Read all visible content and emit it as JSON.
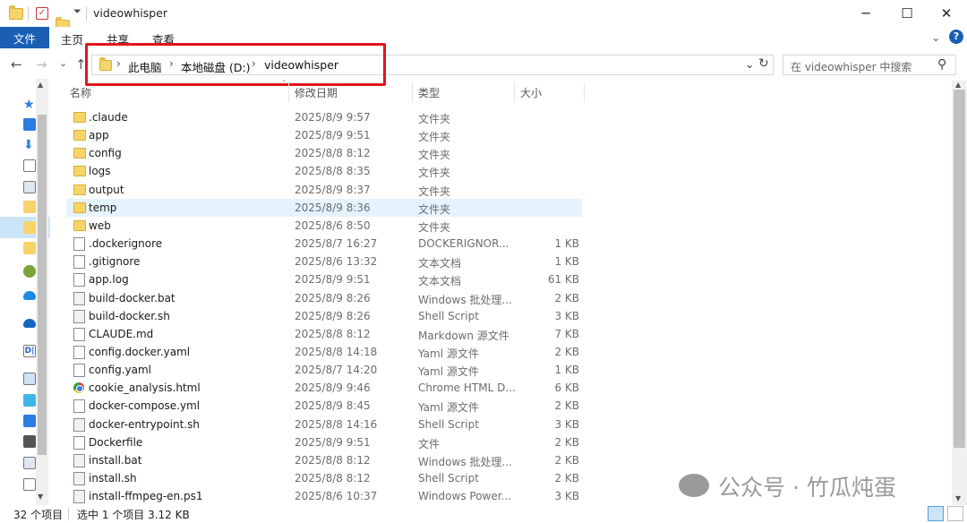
{
  "window": {
    "title": "videowhisper",
    "minimize": "─",
    "maximize": "☐",
    "close": "✕"
  },
  "ribbon": {
    "tabs": [
      "文件",
      "主页",
      "共享",
      "查看"
    ],
    "help": "?",
    "expand": "⌄"
  },
  "nav": {
    "back": "←",
    "forward": "→",
    "recent": "⌄",
    "up": "↑"
  },
  "address": {
    "crumbs": [
      "此电脑",
      "本地磁盘 (D:)",
      "videowhisper"
    ],
    "dropdown": "⌄",
    "refresh": "↻"
  },
  "search": {
    "placeholder": "在 videowhisper 中搜索",
    "icon": "⚲"
  },
  "columns": {
    "name": "名称",
    "date": "修改日期",
    "type": "类型",
    "size": "大小"
  },
  "files": [
    {
      "name": ".claude",
      "date": "2025/8/9 9:57",
      "type": "文件夹",
      "size": "",
      "icon": "folder"
    },
    {
      "name": "app",
      "date": "2025/8/9 9:51",
      "type": "文件夹",
      "size": "",
      "icon": "folder"
    },
    {
      "name": "config",
      "date": "2025/8/8 8:12",
      "type": "文件夹",
      "size": "",
      "icon": "folder"
    },
    {
      "name": "logs",
      "date": "2025/8/8 8:35",
      "type": "文件夹",
      "size": "",
      "icon": "folder"
    },
    {
      "name": "output",
      "date": "2025/8/9 8:37",
      "type": "文件夹",
      "size": "",
      "icon": "folder"
    },
    {
      "name": "temp",
      "date": "2025/8/9 8:36",
      "type": "文件夹",
      "size": "",
      "icon": "folder"
    },
    {
      "name": "web",
      "date": "2025/8/6 8:50",
      "type": "文件夹",
      "size": "",
      "icon": "folder"
    },
    {
      "name": ".dockerignore",
      "date": "2025/8/7 16:27",
      "type": "DOCKERIGNOR...",
      "size": "1 KB",
      "icon": "file"
    },
    {
      "name": ".gitignore",
      "date": "2025/8/6 13:32",
      "type": "文本文档",
      "size": "1 KB",
      "icon": "file"
    },
    {
      "name": "app.log",
      "date": "2025/8/9 9:51",
      "type": "文本文档",
      "size": "61 KB",
      "icon": "file"
    },
    {
      "name": "build-docker.bat",
      "date": "2025/8/9 8:26",
      "type": "Windows 批处理...",
      "size": "2 KB",
      "icon": "gear"
    },
    {
      "name": "build-docker.sh",
      "date": "2025/8/9 8:26",
      "type": "Shell Script",
      "size": "3 KB",
      "icon": "gear"
    },
    {
      "name": "CLAUDE.md",
      "date": "2025/8/8 8:12",
      "type": "Markdown 源文件",
      "size": "7 KB",
      "icon": "file"
    },
    {
      "name": "config.docker.yaml",
      "date": "2025/8/8 14:18",
      "type": "Yaml 源文件",
      "size": "2 KB",
      "icon": "file"
    },
    {
      "name": "config.yaml",
      "date": "2025/8/7 14:20",
      "type": "Yaml 源文件",
      "size": "1 KB",
      "icon": "file"
    },
    {
      "name": "cookie_analysis.html",
      "date": "2025/8/9 9:46",
      "type": "Chrome HTML D...",
      "size": "6 KB",
      "icon": "chrome"
    },
    {
      "name": "docker-compose.yml",
      "date": "2025/8/9 8:45",
      "type": "Yaml 源文件",
      "size": "2 KB",
      "icon": "file"
    },
    {
      "name": "docker-entrypoint.sh",
      "date": "2025/8/8 14:16",
      "type": "Shell Script",
      "size": "3 KB",
      "icon": "gear"
    },
    {
      "name": "Dockerfile",
      "date": "2025/8/9 9:51",
      "type": "文件",
      "size": "2 KB",
      "icon": "file"
    },
    {
      "name": "install.bat",
      "date": "2025/8/8 8:12",
      "type": "Windows 批处理...",
      "size": "2 KB",
      "icon": "gear"
    },
    {
      "name": "install.sh",
      "date": "2025/8/8 8:12",
      "type": "Shell Script",
      "size": "2 KB",
      "icon": "gear"
    },
    {
      "name": "install-ffmpeg-en.ps1",
      "date": "2025/8/6 10:37",
      "type": "Windows Power...",
      "size": "3 KB",
      "icon": "gear"
    }
  ],
  "status": {
    "count": "32 个项目",
    "selection": "选中 1 个项目  3.12 KB"
  },
  "watermark": "公众号 · 竹瓜炖蛋"
}
